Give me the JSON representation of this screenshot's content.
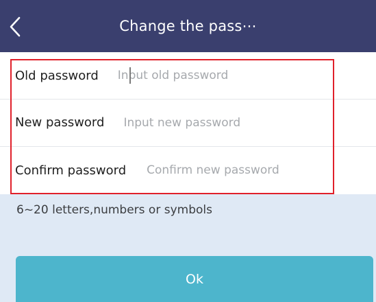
{
  "header": {
    "title": "Change the pass⋯",
    "back_icon": "chevron-left-icon",
    "background": "#3a3f6e"
  },
  "form": {
    "old_password": {
      "label": "Old password",
      "placeholder": "Input old password"
    },
    "new_password": {
      "label": "New password",
      "placeholder": "Input new password"
    },
    "confirm_password": {
      "label": "Confirm password",
      "placeholder": "Confirm new password"
    }
  },
  "hint": "6~20 letters,numbers or symbols",
  "ok_button": {
    "label": "Ok",
    "color": "#4db5cc"
  },
  "highlight_color": "#e0202a"
}
